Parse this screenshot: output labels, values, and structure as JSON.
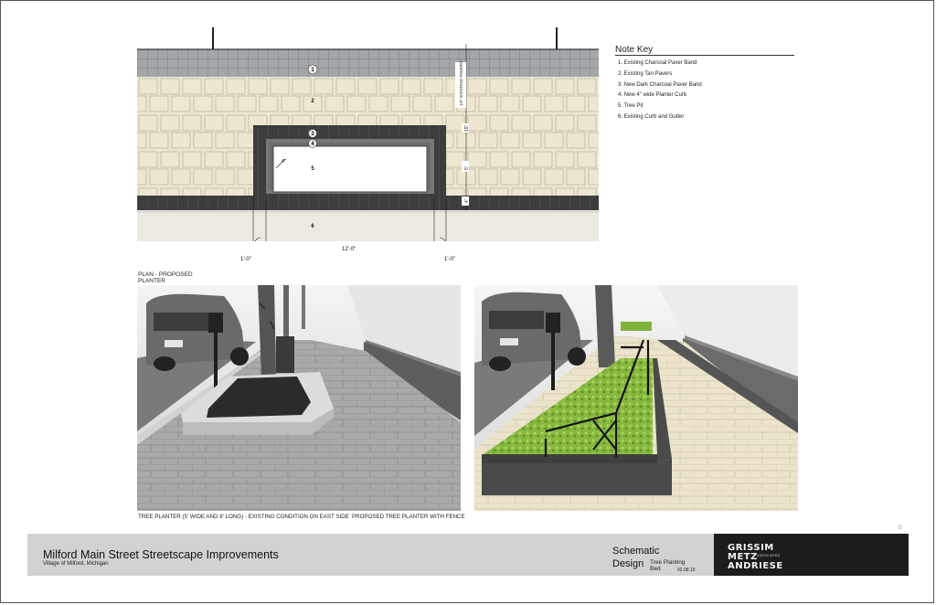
{
  "note_key": {
    "title": "Note Key",
    "items": [
      "1.  Existing Charcoal Paver Band",
      "2.  Existing Tan Pavers",
      "3.  New Dark Charcoal Paver Band",
      "4.  New 4\" wide Planter Curb",
      "5.  Tree Pit",
      "6.  Existing Curb and Gutter"
    ]
  },
  "plan": {
    "caption_line1": "PLAN - PROPOSED",
    "caption_line2": "PLANTER",
    "labels": [
      "1",
      "2",
      "3",
      "4",
      "5",
      "6"
    ],
    "dim_width": "12'-0\"",
    "dim_left": "1'-0\"",
    "dim_right": "1'-0\"",
    "dim_pit": "4\"",
    "side_dims": [
      "15\"",
      "5'",
      "4'",
      "1'"
    ],
    "note_vertical": "1/2\" EXISTING PAVERS"
  },
  "photos": {
    "left_caption": "TREE PLANTER (5' WIDE AND 8' LONG) - EXISTING CONDITION ON EAST SIDE",
    "right_caption": "PROPOSED TREE PLANTER WITH FENCE"
  },
  "page_number": "6",
  "title_block": {
    "project": "Milford Main Street Streetscape Improvements",
    "location": "Village of Milford, Michigan",
    "stage_line1": "Schematic",
    "stage_line2": "Design",
    "sheet_title": "Tree Planting Bed",
    "date": "02.08.19"
  },
  "logo": {
    "line1": "GRISSIM",
    "line2": "METZ",
    "line3": "ANDRIESE",
    "associates": "ASSOCIATES"
  },
  "colors": {
    "charcoal_band": "#9a9ea1",
    "tan_paver": "#ece7d6",
    "dark_charcoal": "#3b3b3b",
    "curb": "#e8e6df",
    "planting": "#7fb33a",
    "logo_bg": "#1c1c1c",
    "title_bar": "#d2d2d2"
  }
}
